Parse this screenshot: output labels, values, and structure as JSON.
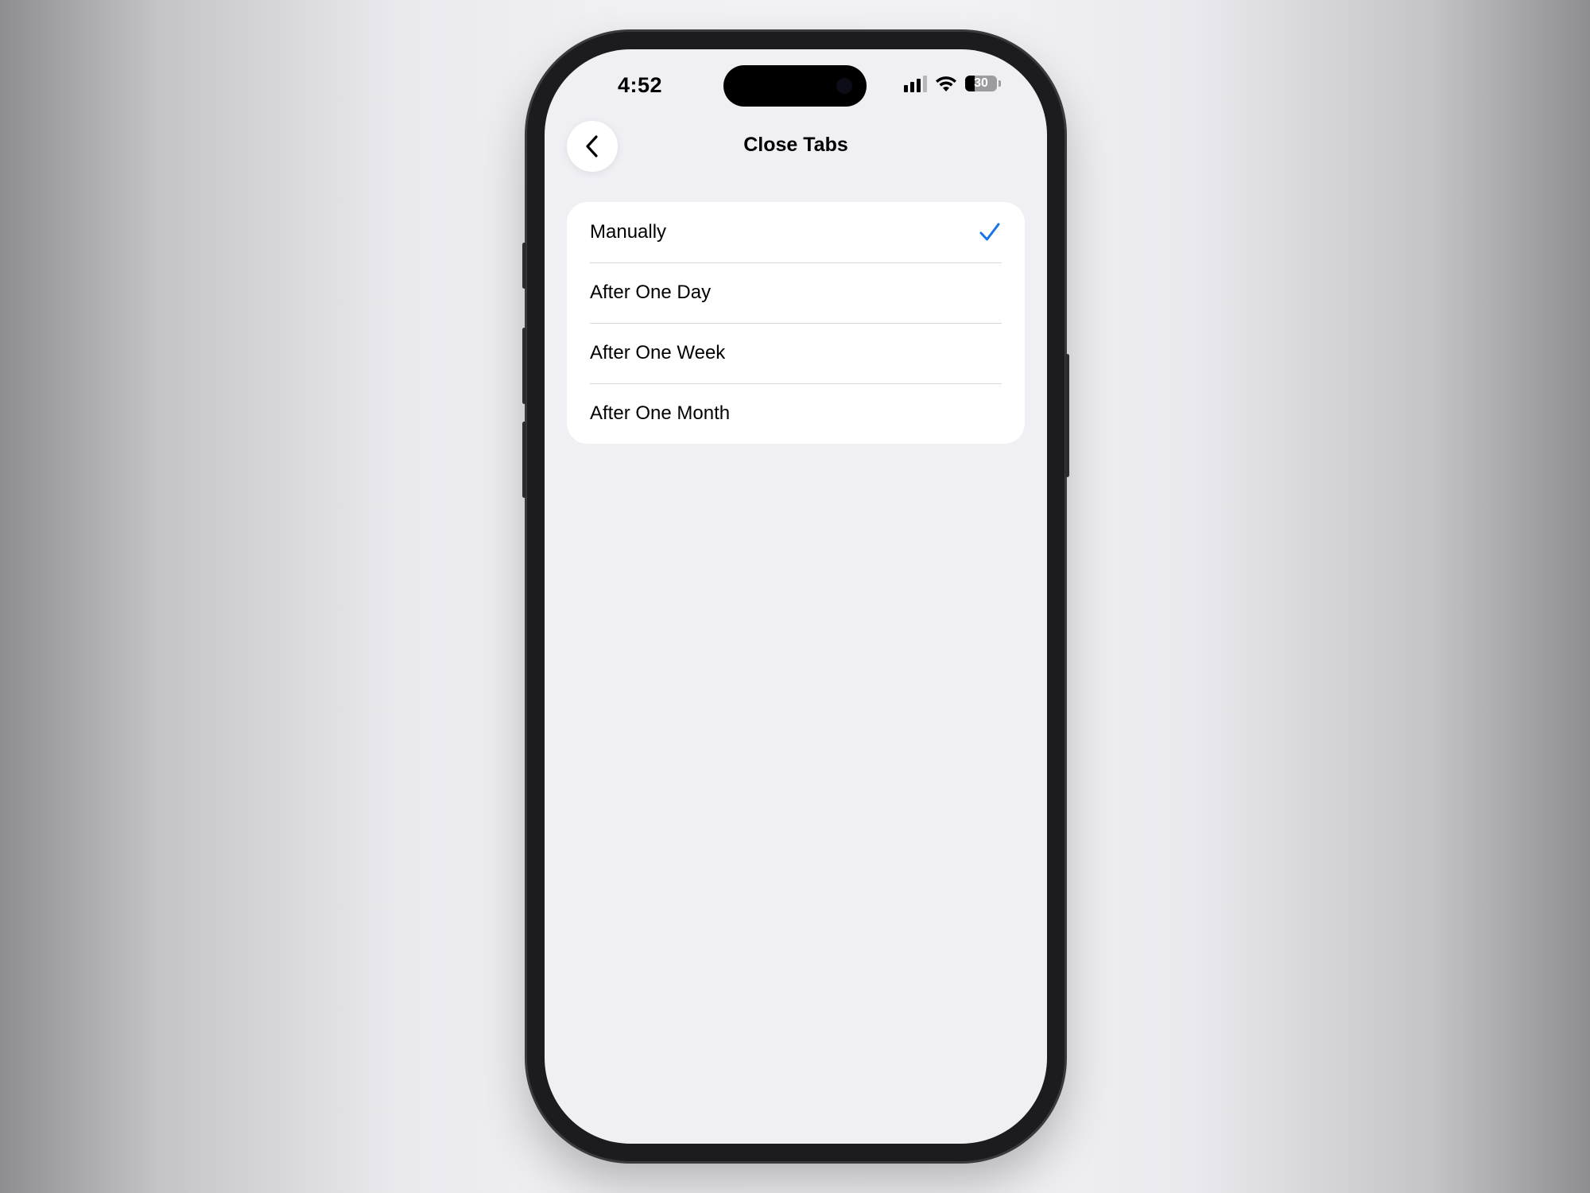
{
  "status_bar": {
    "time": "4:52",
    "battery_level": "30",
    "battery_fraction": 0.3
  },
  "header": {
    "title": "Close Tabs",
    "back_icon": "chevron-left-icon"
  },
  "options": [
    {
      "label": "Manually",
      "selected": true
    },
    {
      "label": "After One Day",
      "selected": false
    },
    {
      "label": "After One Week",
      "selected": false
    },
    {
      "label": "After One Month",
      "selected": false
    }
  ],
  "colors": {
    "accent": "#1a73e8",
    "background": "#efeff4",
    "card": "#ffffff",
    "separator": "#d8d8dc"
  }
}
